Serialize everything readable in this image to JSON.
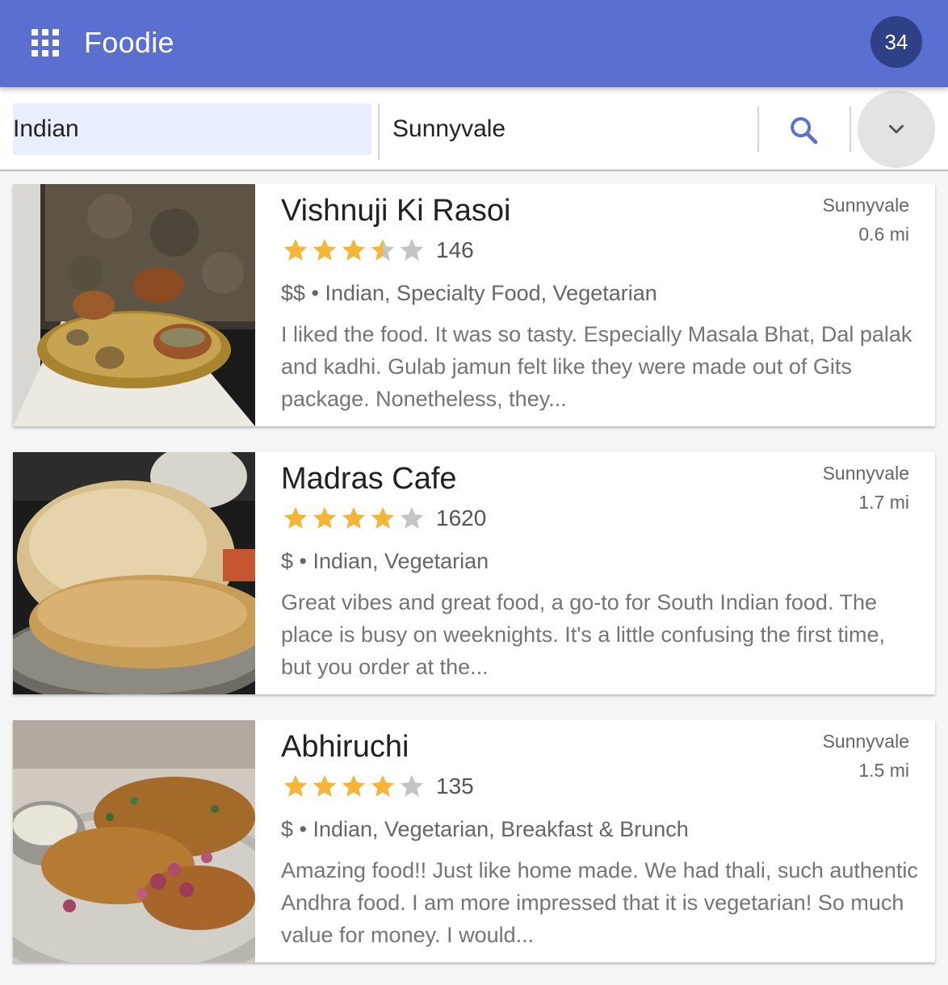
{
  "app": {
    "title": "Foodie",
    "badge": "34",
    "accent": "#5a6fd0",
    "badge_color": "#2e4187"
  },
  "search": {
    "query": "Indian",
    "location": "Sunnyvale",
    "search_icon": "search-icon",
    "expand_icon": "chevron-down-icon"
  },
  "results": [
    {
      "name": "Vishnuji Ki Rasoi",
      "rating": 3.5,
      "review_count": "146",
      "price_categories": "$$ • Indian, Specialty Food, Vegetarian",
      "review": "I liked the food. It was so tasty. Especially Masala Bhat, Dal palak and kadhi. Gulab jamun felt like they were made out of Gits package. Nonetheless, they...",
      "city": "Sunnyvale",
      "distance": "0.6 mi"
    },
    {
      "name": "Madras Cafe",
      "rating": 4,
      "review_count": "1620",
      "price_categories": "$ • Indian, Vegetarian",
      "review": "Great vibes and great food, a go-to for South Indian food. The place is busy on weeknights. It's a little confusing the first time, but you order at the...",
      "city": "Sunnyvale",
      "distance": "1.7 mi"
    },
    {
      "name": "Abhiruchi",
      "rating": 4,
      "review_count": "135",
      "price_categories": "$ • Indian, Vegetarian, Breakfast & Brunch",
      "review": "Amazing food!! Just like home made. We had thali, such authentic Andhra food. I am more impressed that it is vegetarian! So much value for money. I would...",
      "city": "Sunnyvale",
      "distance": "1.5 mi"
    }
  ]
}
